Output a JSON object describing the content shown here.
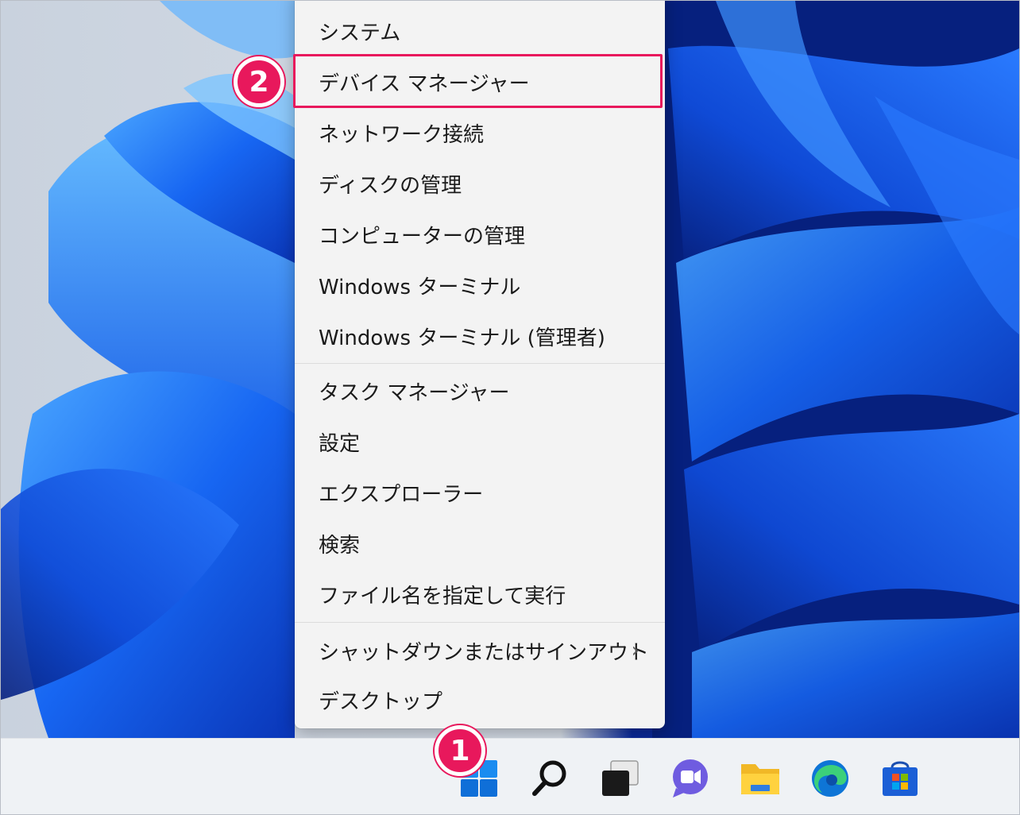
{
  "context_menu": {
    "items": [
      {
        "label": "システム"
      },
      {
        "label": "デバイス マネージャー"
      },
      {
        "label": "ネットワーク接続"
      },
      {
        "label": "ディスクの管理"
      },
      {
        "label": "コンピューターの管理"
      },
      {
        "label": "Windows ターミナル"
      },
      {
        "label": "Windows ターミナル (管理者)"
      },
      {
        "label": "タスク マネージャー"
      },
      {
        "label": "設定"
      },
      {
        "label": "エクスプローラー"
      },
      {
        "label": "検索"
      },
      {
        "label": "ファイル名を指定して実行"
      },
      {
        "label": "シャットダウンまたはサインアウト",
        "submenu_icon": "chevron-right-icon",
        "submenu_glyph": "›"
      },
      {
        "label": "デスクトップ"
      }
    ],
    "highlighted_item": "デバイス マネージャー"
  },
  "annotations": {
    "step1": "1",
    "step2": "2",
    "highlight_color": "#e8185c"
  },
  "taskbar": {
    "icons": [
      {
        "name": "start-icon"
      },
      {
        "name": "search-icon"
      },
      {
        "name": "task-view-icon"
      },
      {
        "name": "chat-icon"
      },
      {
        "name": "file-explorer-icon"
      },
      {
        "name": "edge-icon"
      },
      {
        "name": "store-icon"
      }
    ]
  },
  "colors": {
    "wallpaper_blue": "#1a5cff",
    "wallpaper_dark": "#041a6e",
    "menu_bg": "#f3f3f3",
    "taskbar_bg": "#eff2f5"
  }
}
